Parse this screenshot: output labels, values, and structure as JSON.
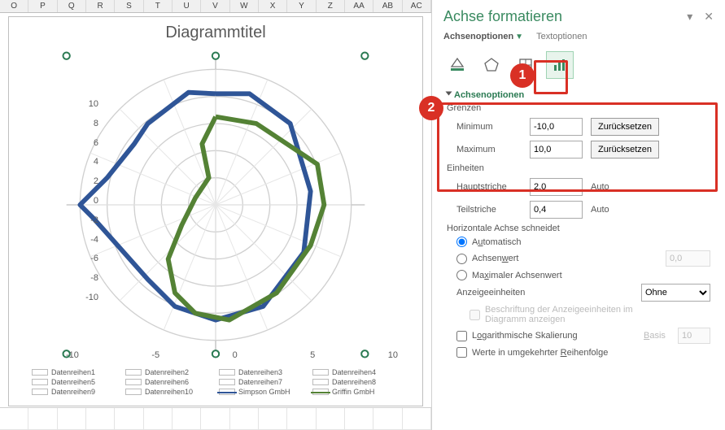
{
  "columns": [
    "O",
    "P",
    "Q",
    "R",
    "S",
    "T",
    "U",
    "V",
    "W",
    "X",
    "Y",
    "Z",
    "AA",
    "AB",
    "AC"
  ],
  "chart": {
    "title": "Diagrammtitel",
    "hticks": [
      "-10",
      "-5",
      "0",
      "5",
      "10"
    ],
    "vticks": [
      "10",
      "8",
      "6",
      "4",
      "2",
      "0",
      "-2",
      "-4",
      "-6",
      "-8",
      "-10"
    ],
    "legend": [
      {
        "label": "Datenreihen1"
      },
      {
        "label": "Datenreihen2"
      },
      {
        "label": "Datenreihen3"
      },
      {
        "label": "Datenreihen4"
      },
      {
        "label": "Datenreihen5"
      },
      {
        "label": "Datenreihen6"
      },
      {
        "label": "Datenreihen7"
      },
      {
        "label": "Datenreihen8"
      },
      {
        "label": "Datenreihen9"
      },
      {
        "label": "Datenreihen10"
      },
      {
        "label": "Simpson GmbH",
        "color": "#2f5597"
      },
      {
        "label": "Griffin GmbH",
        "color": "#548235"
      }
    ]
  },
  "chart_data": {
    "type": "scatter",
    "title": "Diagrammtitel",
    "xlabel": "",
    "ylabel": "",
    "xlim": [
      -10,
      10
    ],
    "ylim": [
      -10,
      10
    ],
    "xticks": [
      -10,
      -5,
      0,
      5,
      10
    ],
    "yticks": [
      -10,
      -8,
      -6,
      -4,
      -2,
      0,
      2,
      4,
      6,
      8,
      10
    ],
    "series": [
      {
        "name": "Simpson GmbH",
        "color": "#2f5597",
        "points": [
          [
            0,
            8.2
          ],
          [
            2.5,
            8.2
          ],
          [
            5.5,
            6
          ],
          [
            7,
            1
          ],
          [
            6.5,
            -3.5
          ],
          [
            3.5,
            -7.5
          ],
          [
            0,
            -8.5
          ],
          [
            -3,
            -7.5
          ],
          [
            -5,
            -5.5
          ],
          [
            -9,
            -1
          ],
          [
            -10,
            0
          ],
          [
            -8,
            2
          ],
          [
            -6,
            4.5
          ],
          [
            -5,
            6
          ],
          [
            -2,
            8.3
          ],
          [
            0,
            8.2
          ]
        ]
      },
      {
        "name": "Griffin GmbH",
        "color": "#548235",
        "points": [
          [
            0,
            6.5
          ],
          [
            3,
            6
          ],
          [
            7.5,
            3
          ],
          [
            8,
            0
          ],
          [
            7,
            -3
          ],
          [
            4.5,
            -6.5
          ],
          [
            1,
            -8.5
          ],
          [
            -1.5,
            -8
          ],
          [
            -3,
            -6.5
          ],
          [
            -3.5,
            -4
          ],
          [
            -2.5,
            -1.5
          ],
          [
            -1.5,
            0.5
          ],
          [
            -0.5,
            2
          ],
          [
            -1,
            4.5
          ],
          [
            0,
            6.5
          ]
        ]
      }
    ]
  },
  "pane": {
    "title": "Achse formatieren",
    "tabs": {
      "achsen": "Achsenoptionen",
      "text": "Textoptionen"
    },
    "sections": {
      "achsenoptionen": "Achsenoptionen",
      "grenzen": "Grenzen",
      "min": "Minimum",
      "min_val": "-10,0",
      "max": "Maximum",
      "max_val": "10,0",
      "reset": "Zurücksetzen",
      "einheiten": "Einheiten",
      "haupt": "Hauptstriche",
      "haupt_val": "2,0",
      "teil": "Teilstriche",
      "teil_val": "0,4",
      "auto": "Auto",
      "hachse": "Horizontale Achse schneidet",
      "automatisch": "Automatisch",
      "achsenwert": "Achsenwert",
      "achsenwert_val": "0,0",
      "maxachs": "Maximaler Achsenwert",
      "anzeige": "Anzeigeeinheiten",
      "anzeige_val": "Ohne",
      "beschr": "Beschriftung der Anzeigeeinheiten im Diagramm anzeigen",
      "log": "Logarithmische Skalierung",
      "basis": "Basis",
      "basis_val": "10",
      "umkehr": "Werte in umgekehrter Reihenfolge"
    }
  },
  "annotations": {
    "one": "1",
    "two": "2"
  }
}
